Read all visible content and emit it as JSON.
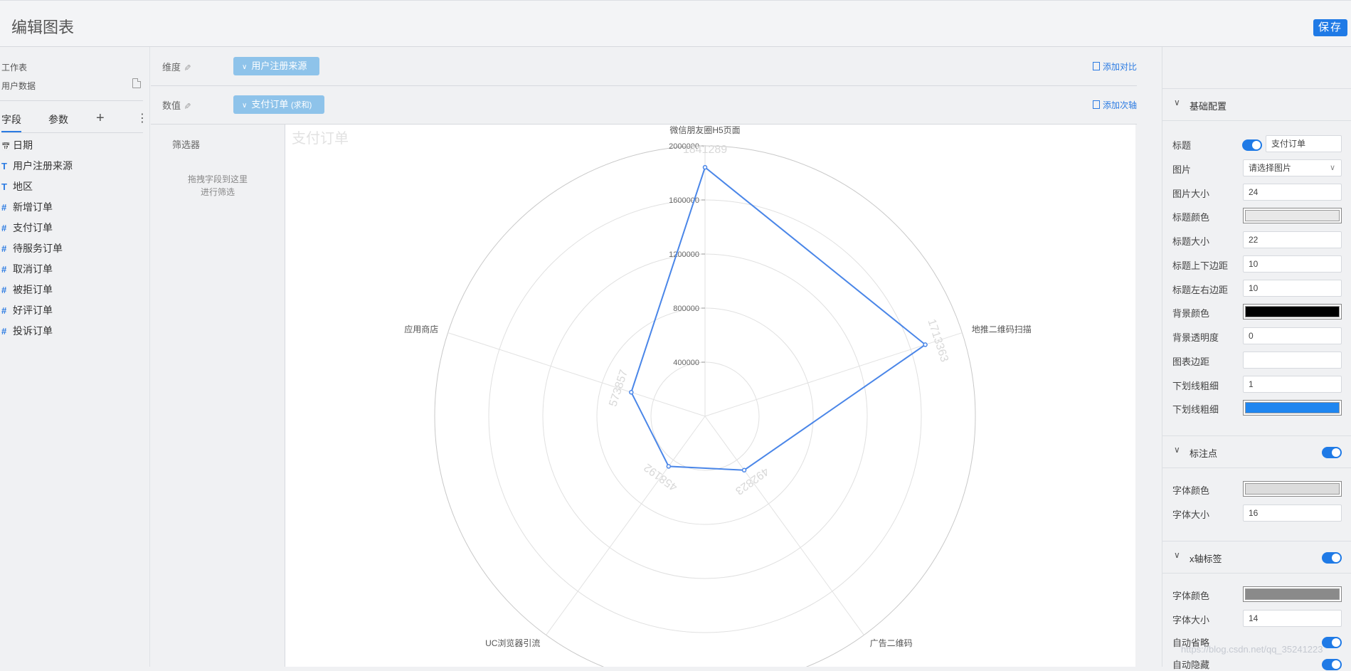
{
  "header": {
    "title": "编辑图表",
    "save_label": "保存"
  },
  "left": {
    "worksheet_label": "工作表",
    "dataset_name": "用户数据",
    "tabs": {
      "fields": "字段",
      "params": "参数"
    },
    "fields": [
      {
        "type": "date",
        "icon": "📅",
        "label": "日期"
      },
      {
        "type": "text",
        "icon": "T",
        "label": "用户注册来源"
      },
      {
        "type": "text",
        "icon": "T",
        "label": "地区"
      },
      {
        "type": "number",
        "icon": "#",
        "label": "新增订单"
      },
      {
        "type": "number",
        "icon": "#",
        "label": "支付订单"
      },
      {
        "type": "number",
        "icon": "#",
        "label": "待服务订单"
      },
      {
        "type": "number",
        "icon": "#",
        "label": "取消订单"
      },
      {
        "type": "number",
        "icon": "#",
        "label": "被拒订单"
      },
      {
        "type": "number",
        "icon": "#",
        "label": "好评订单"
      },
      {
        "type": "number",
        "icon": "#",
        "label": "投诉订单"
      }
    ]
  },
  "dimension": {
    "label": "维度",
    "pill": "用户注册来源",
    "add_link": "添加对比"
  },
  "value": {
    "label": "数值",
    "pill": "支付订单",
    "agg": "(求和)",
    "add_link": "添加次轴"
  },
  "filter": {
    "title": "筛选器",
    "hint_line1": "拖拽字段到这里",
    "hint_line2": "进行筛选"
  },
  "chart_data": {
    "type": "radar",
    "title": "支付订单",
    "categories": [
      "微信朋友圈H5页面",
      "地推二维码扫描",
      "广告二维码",
      "UC浏览器引流",
      "应用商店"
    ],
    "values": [
      1841289,
      1713363,
      492823,
      458192,
      573857
    ],
    "value_labels": [
      "1841289",
      "1713363",
      "492823",
      "458192",
      "573857"
    ],
    "max": 2000000,
    "ticks": [
      "400000",
      "800000",
      "1200000",
      "1600000",
      "2000000"
    ],
    "series_color": "#4a86e8"
  },
  "panel": {
    "basic": {
      "header": "基础配置",
      "rows": {
        "title": {
          "label": "标题",
          "value": "支付订单"
        },
        "image": {
          "label": "图片",
          "value": "请选择图片"
        },
        "image_size": {
          "label": "图片大小",
          "value": "24"
        },
        "title_color": {
          "label": "标题颜色",
          "color": "#e8e8e8"
        },
        "title_size": {
          "label": "标题大小",
          "value": "22"
        },
        "title_vpad": {
          "label": "标题上下边距",
          "value": "10"
        },
        "title_hpad": {
          "label": "标题左右边距",
          "value": "10"
        },
        "bg_color": {
          "label": "背景颜色",
          "color": "#000000"
        },
        "bg_opacity": {
          "label": "背景透明度",
          "value": "0"
        },
        "chart_margin": {
          "label": "图表边距",
          "value": ""
        },
        "underline_w": {
          "label": "下划线粗细",
          "value": "1"
        },
        "underline_c": {
          "label": "下划线粗细",
          "color": "#1f86f0"
        }
      }
    },
    "marker": {
      "header": "标注点",
      "font_color": {
        "label": "字体颜色",
        "color": "#dcdcdc"
      },
      "font_size": {
        "label": "字体大小",
        "value": "16"
      }
    },
    "xaxis": {
      "header": "x轴标签",
      "font_color": {
        "label": "字体颜色",
        "color": "#8a8a8a"
      },
      "font_size": {
        "label": "字体大小",
        "value": "14"
      },
      "auto_ellipsis": "自动省略",
      "auto_hide": "自动隐藏"
    }
  },
  "watermark": "https://blog.csdn.net/qq_35241223"
}
